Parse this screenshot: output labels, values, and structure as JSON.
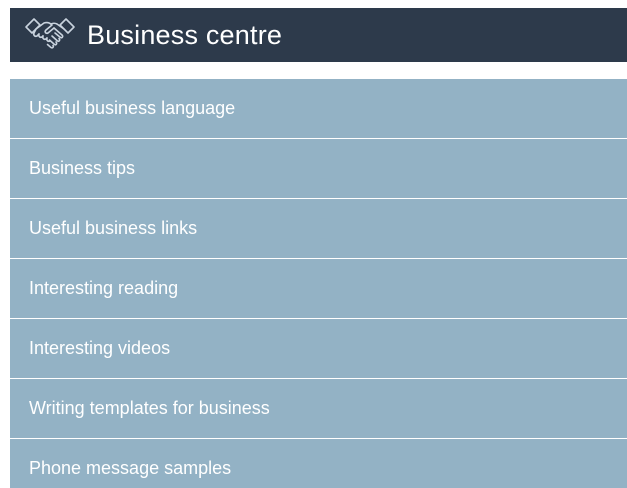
{
  "header": {
    "title": "Business centre",
    "icon": "handshake-icon",
    "background_color": "#2d3a4b"
  },
  "menu": {
    "item_color": "#93b2c5",
    "items": [
      {
        "label": "Useful business language"
      },
      {
        "label": "Business tips"
      },
      {
        "label": "Useful business links"
      },
      {
        "label": "Interesting reading"
      },
      {
        "label": "Interesting videos"
      },
      {
        "label": "Writing templates for business"
      },
      {
        "label": "Phone message samples"
      }
    ]
  }
}
